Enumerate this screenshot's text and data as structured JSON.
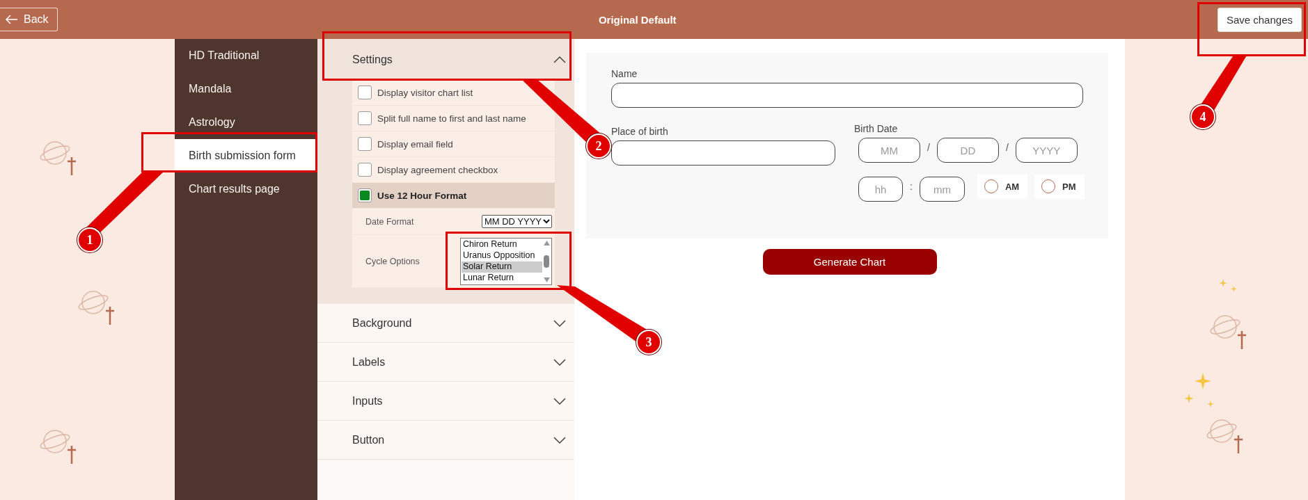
{
  "top_bar": {
    "back_label": "Back",
    "title": "Original Default",
    "save_label": "Save changes"
  },
  "sidebar": {
    "items": [
      {
        "label": "HD Traditional",
        "selected": false
      },
      {
        "label": "Mandala",
        "selected": false
      },
      {
        "label": "Astrology",
        "selected": false
      },
      {
        "label": "Birth submission form",
        "selected": true
      },
      {
        "label": "Chart results page",
        "selected": false
      }
    ]
  },
  "accordion": [
    {
      "title": "Settings",
      "expanded": true,
      "options": [
        {
          "label": "Display visitor chart list",
          "checked": false
        },
        {
          "label": "Split full name to first and last name",
          "checked": false
        },
        {
          "label": "Display email field",
          "checked": false
        },
        {
          "label": "Display agreement checkbox",
          "checked": false
        },
        {
          "label": "Use 12 Hour Format",
          "checked": true
        }
      ],
      "date_format": {
        "label": "Date Format",
        "value": "MM DD YYYY"
      },
      "cycle_options": {
        "label": "Cycle Options",
        "items": [
          {
            "label": "Chiron Return",
            "selected": false
          },
          {
            "label": "Uranus Opposition",
            "selected": false
          },
          {
            "label": "Solar Return",
            "selected": true
          },
          {
            "label": "Lunar Return",
            "selected": false
          }
        ]
      }
    },
    {
      "title": "Background",
      "expanded": false
    },
    {
      "title": "Labels",
      "expanded": false
    },
    {
      "title": "Inputs",
      "expanded": false
    },
    {
      "title": "Button",
      "expanded": false
    }
  ],
  "form": {
    "name_label": "Name",
    "place_label": "Place of birth",
    "birth_date_label": "Birth Date",
    "date_placeholders": [
      "MM",
      "DD",
      "YYYY"
    ],
    "date_separators": [
      "/",
      "/"
    ],
    "time_placeholders": [
      "hh",
      "mm"
    ],
    "time_separator": ":",
    "meridiem": [
      {
        "label": "AM",
        "selected": false
      },
      {
        "label": "PM",
        "selected": false
      }
    ],
    "submit_label": "Generate Chart"
  },
  "annotations": [
    {
      "number": "1"
    },
    {
      "number": "2"
    },
    {
      "number": "3"
    },
    {
      "number": "4"
    }
  ]
}
